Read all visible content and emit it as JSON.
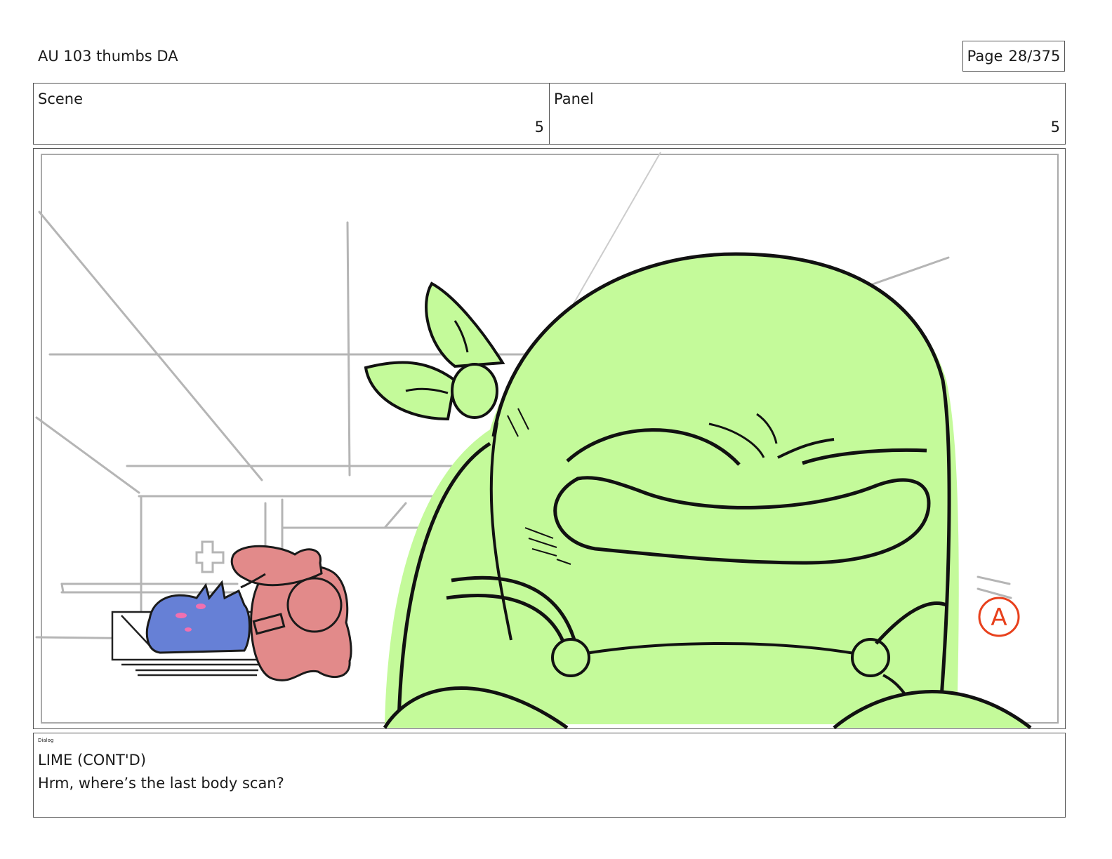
{
  "header": {
    "title": "AU 103 thumbs DA",
    "page_label": "Page",
    "page_value": "28/375"
  },
  "info": {
    "scene_label": "Scene",
    "scene_value": "5",
    "panel_label": "Panel",
    "panel_value": "5"
  },
  "dialog": {
    "label": "Dialog",
    "speaker": "LIME (CONT'D)",
    "line": "Hrm, where’s the last body scan?"
  },
  "colors": {
    "character_green": "#c4fa9a",
    "character_pink": "#e28a8a",
    "character_blue": "#6680d6",
    "sketch_gray": "#b5b5b5",
    "stamp_red": "#e8401c"
  },
  "stamp": {
    "letter": "A"
  }
}
